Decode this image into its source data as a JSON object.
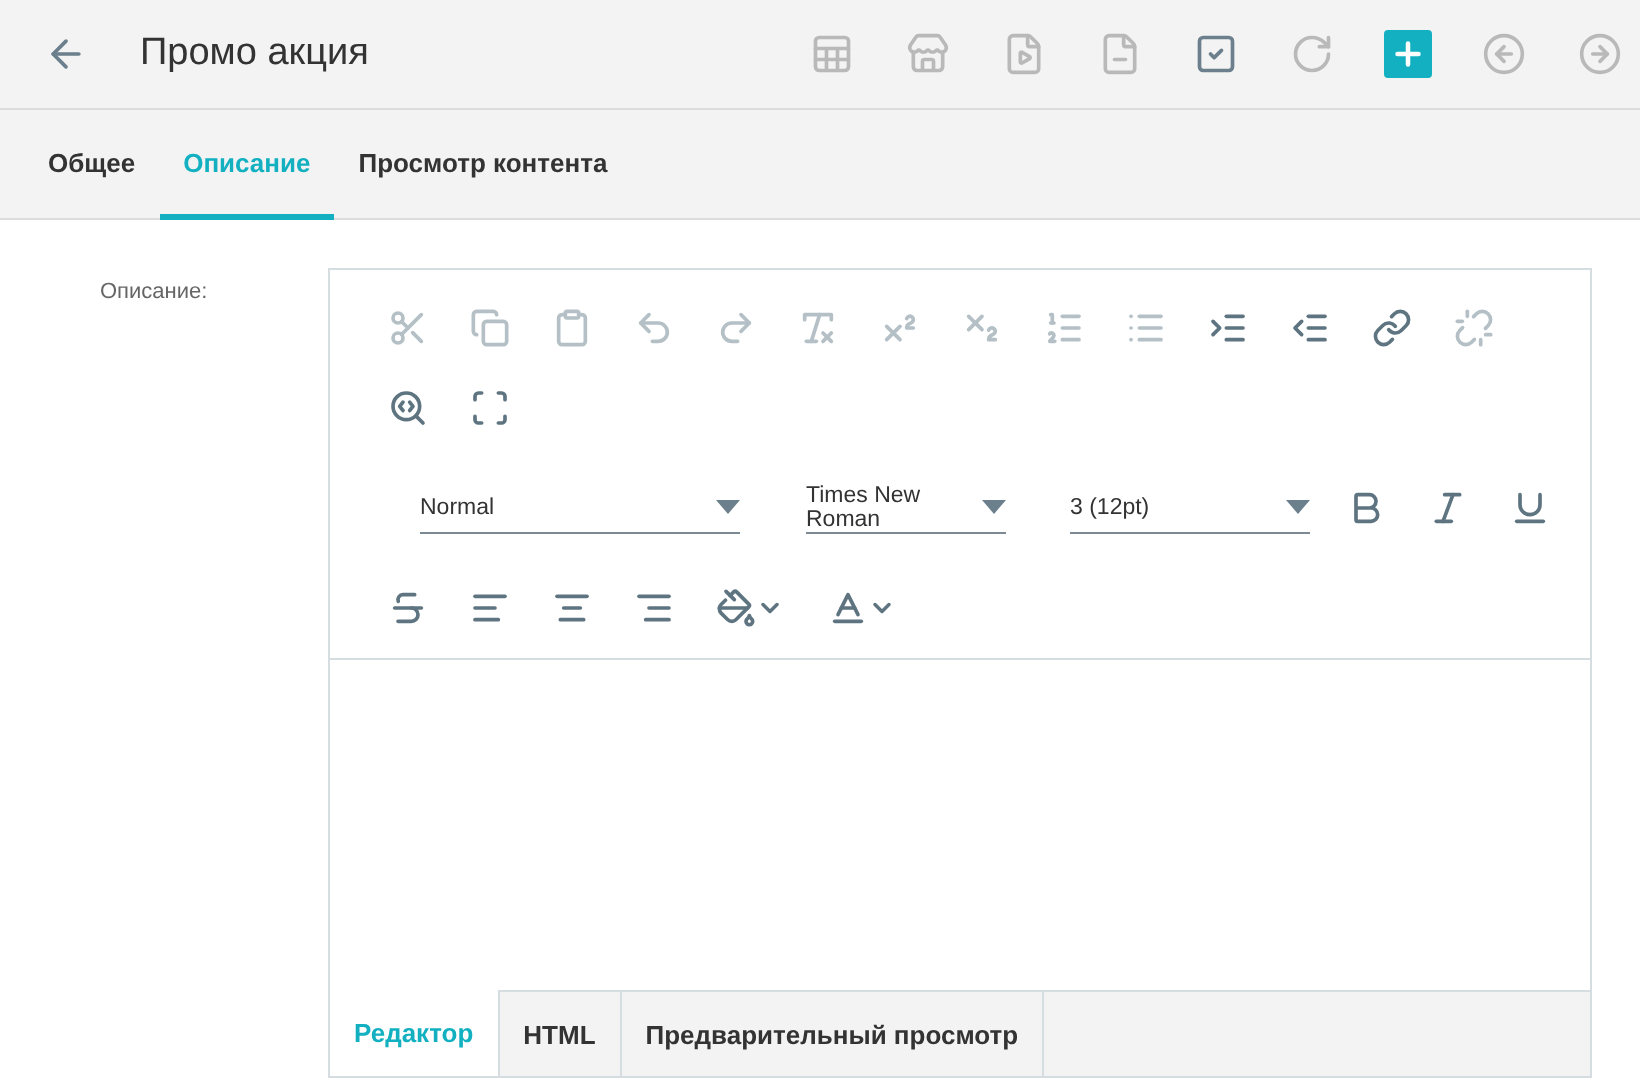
{
  "header": {
    "back": true,
    "title": "Промо акция",
    "tools": [
      {
        "kind": "table-remove",
        "disabled": true
      },
      {
        "kind": "store",
        "disabled": true
      },
      {
        "kind": "file-play",
        "disabled": true
      },
      {
        "kind": "file-minus",
        "disabled": true
      },
      {
        "kind": "checkbox",
        "disabled": false
      },
      {
        "kind": "refresh",
        "disabled": true
      },
      {
        "kind": "add",
        "disabled": false
      },
      {
        "kind": "previous",
        "disabled": true
      },
      {
        "kind": "next",
        "disabled": true
      }
    ]
  },
  "tabs": [
    {
      "label": "Общее",
      "selected": false
    },
    {
      "label": "Описание",
      "selected": true
    },
    {
      "label": "Просмотр контента",
      "selected": false
    }
  ],
  "field": {
    "label": "Описание:"
  },
  "editor": {
    "row1": [
      {
        "kind": "cut",
        "disabled": true
      },
      {
        "kind": "copy",
        "disabled": true
      },
      {
        "kind": "paste",
        "disabled": true
      },
      {
        "kind": "undo",
        "disabled": true
      },
      {
        "kind": "redo",
        "disabled": true
      },
      {
        "kind": "clear-format",
        "disabled": true
      },
      {
        "kind": "superscript",
        "disabled": true
      },
      {
        "kind": "subscript",
        "disabled": true
      },
      {
        "kind": "ordered-list",
        "disabled": true
      },
      {
        "kind": "bullet-list",
        "disabled": true
      },
      {
        "kind": "indent",
        "disabled": false
      },
      {
        "kind": "outdent",
        "disabled": false
      },
      {
        "kind": "link",
        "disabled": false
      },
      {
        "kind": "unlink",
        "disabled": true
      },
      {
        "kind": "find",
        "disabled": false
      },
      {
        "kind": "fullscreen",
        "disabled": false
      }
    ],
    "selects": [
      {
        "value": "Normal"
      },
      {
        "value": "Times New Roman"
      },
      {
        "value": "3 (12pt)"
      }
    ],
    "row2": [
      {
        "kind": "bold",
        "disabled": false
      },
      {
        "kind": "italic",
        "disabled": false
      },
      {
        "kind": "underline",
        "disabled": false
      }
    ],
    "row3": [
      {
        "kind": "strikethrough",
        "disabled": false
      },
      {
        "kind": "align-left",
        "disabled": false
      },
      {
        "kind": "align-center",
        "disabled": false
      },
      {
        "kind": "align-right",
        "disabled": false
      },
      {
        "kind": "fill-color",
        "disabled": false
      },
      {
        "kind": "text-color",
        "disabled": false
      }
    ],
    "modes": [
      {
        "label": "Редактор",
        "selected": true
      },
      {
        "label": "HTML",
        "selected": false
      },
      {
        "label": "Предварительный просмотр",
        "selected": false
      }
    ]
  }
}
